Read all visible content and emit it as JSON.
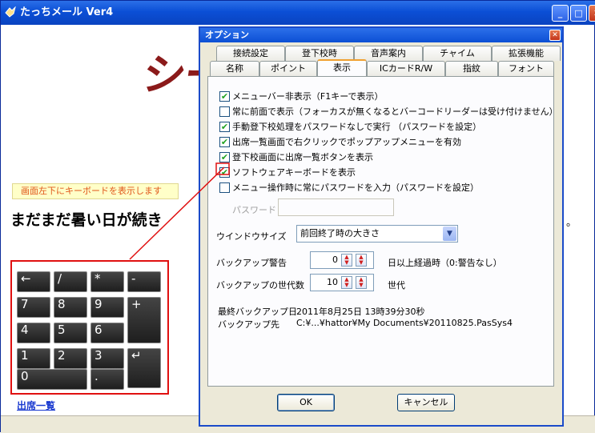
{
  "main": {
    "title": "たっちメール Ver4",
    "banner": "シー",
    "hint": "画面左下にキーボードを表示します",
    "message": "まだまだ暑い日が続き",
    "trailing_dot": "。",
    "attendance_link": "出席一覧"
  },
  "keyboard": {
    "keys": [
      "←",
      "/",
      "*",
      "-",
      "7",
      "8",
      "9",
      "+",
      "4",
      "5",
      "6",
      "1",
      "2",
      "3",
      "↵",
      "0",
      "."
    ]
  },
  "dialog": {
    "title": "オプション",
    "tabs_row1": [
      "接続設定",
      "登下校時",
      "音声案内",
      "チャイム",
      "拡張機能"
    ],
    "tabs_row2": [
      "名称",
      "ポイント",
      "表示",
      "ICカードR/W",
      "指紋",
      "フォント"
    ],
    "active_tab": "表示",
    "checkboxes": [
      {
        "label": "メニューバー非表示（F1キーで表示）",
        "checked": true
      },
      {
        "label": "常に前面で表示（フォーカスが無くなるとバーコードリーダーは受け付けません）",
        "checked": false
      },
      {
        "label": "手動登下校処理をパスワードなしで実行 （パスワードを設定）",
        "checked": true
      },
      {
        "label": "出席一覧画面で右クリックでポップアップメニューを有効",
        "checked": true
      },
      {
        "label": "登下校画面に出席一覧ボタンを表示",
        "checked": true
      },
      {
        "label": "ソフトウェアキーボードを表示",
        "checked": true
      },
      {
        "label": "メニュー操作時に常にパスワードを入力（パスワードを設定）",
        "checked": false
      }
    ],
    "password_label": "パスワード",
    "password_value": "",
    "window_size_label": "ウインドウサイズ",
    "window_size_value": "前回終了時の大きさ",
    "backup_warning_label": "バックアップ警告",
    "backup_warning_value": "0",
    "backup_warning_suffix": "日以上経過時（0:警告なし）",
    "backup_generations_label": "バックアップの世代数",
    "backup_generations_value": "10",
    "backup_generations_suffix": "世代",
    "last_backup_label": "最終バックアップ日",
    "last_backup_value": "2011年8月25日  13時39分30秒",
    "backup_dest_label": "バックアップ先",
    "backup_dest_value": "C:¥...¥hattor¥My Documents¥20110825.PasSys4",
    "ok_label": "OK",
    "cancel_label": "キャンセル"
  },
  "colors": {
    "title_blue": "#0b4fd6",
    "banner": "#8b1a1a",
    "highlight_red": "#e01010",
    "hint_text": "#e0561a"
  }
}
